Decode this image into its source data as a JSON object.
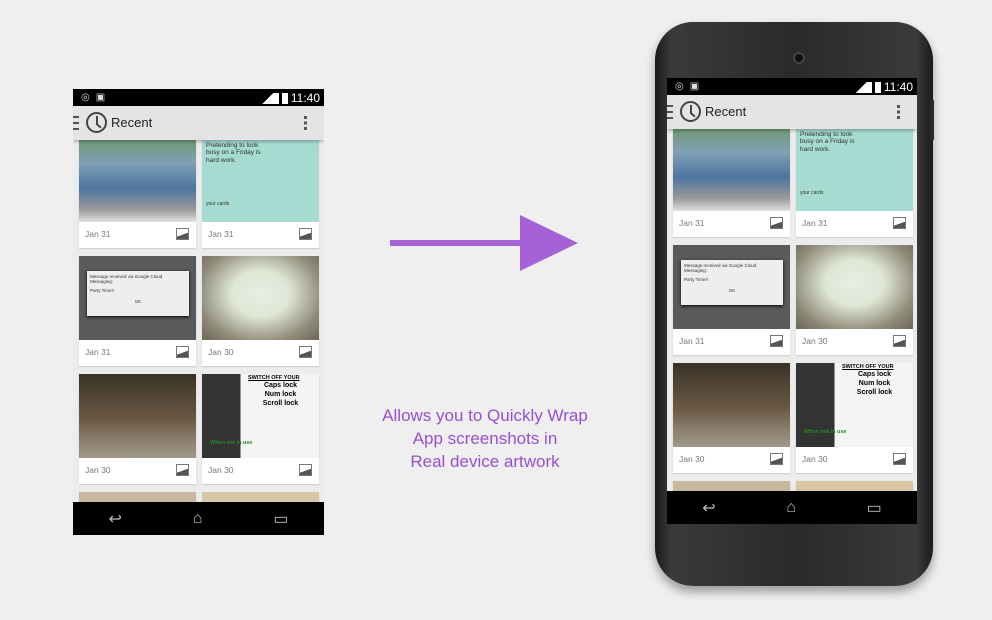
{
  "status_bar": {
    "time": "11:40"
  },
  "action_bar": {
    "title": "Recent"
  },
  "cards": [
    {
      "date": "Jan 31",
      "kind": "photo-jeans"
    },
    {
      "date": "Jan 31",
      "kind": "meme",
      "text": "Pretending to look busy on a Friday is hard work.",
      "brand": "your cards"
    },
    {
      "date": "Jan 31",
      "kind": "dialog",
      "message": "Message received via Google Cloud Messaging:",
      "body": "Party Time!!",
      "ok": "OK"
    },
    {
      "date": "Jan 30",
      "kind": "photo-blur"
    },
    {
      "date": "Jan 30",
      "kind": "photo-lego"
    },
    {
      "date": "Jan 30",
      "kind": "meme-keyboard",
      "heading": "SWITCH OFF YOUR",
      "lines": [
        "Caps lock",
        "Num lock",
        "Scroll lock"
      ],
      "footer": "When not in use"
    }
  ],
  "tagline": [
    "Allows you to Quickly Wrap",
    "App screenshots in",
    "Real device artwork"
  ],
  "colors": {
    "accent": "#a562d6",
    "text_accent": "#9a4fd3"
  }
}
